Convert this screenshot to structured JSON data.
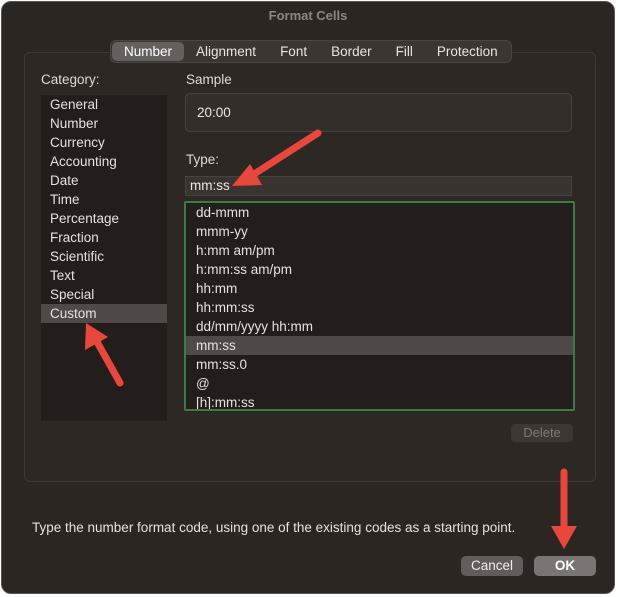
{
  "window": {
    "title": "Format Cells"
  },
  "tabs": [
    {
      "label": "Number",
      "active": true
    },
    {
      "label": "Alignment",
      "active": false
    },
    {
      "label": "Font",
      "active": false
    },
    {
      "label": "Border",
      "active": false
    },
    {
      "label": "Fill",
      "active": false
    },
    {
      "label": "Protection",
      "active": false
    }
  ],
  "category": {
    "label": "Category:",
    "items": [
      "General",
      "Number",
      "Currency",
      "Accounting",
      "Date",
      "Time",
      "Percentage",
      "Fraction",
      "Scientific",
      "Text",
      "Special",
      "Custom"
    ],
    "selected": "Custom"
  },
  "sample": {
    "label": "Sample",
    "value": "20:00"
  },
  "type": {
    "label": "Type:",
    "value": "mm:ss",
    "formats": [
      "dd-mmm",
      "mmm-yy",
      "h:mm am/pm",
      "h:mm:ss am/pm",
      "hh:mm",
      "hh:mm:ss",
      "dd/mm/yyyy hh:mm",
      "mm:ss",
      "mm:ss.0",
      "@",
      "[h]:mm:ss"
    ],
    "selected": "mm:ss"
  },
  "buttons": {
    "delete": "Delete",
    "cancel": "Cancel",
    "ok": "OK"
  },
  "hint": "Type the number format code, using one of the existing codes as a starting point.",
  "colors": {
    "annotation_arrow": "#e8473c",
    "list_highlight_border": "#3a7d44"
  }
}
